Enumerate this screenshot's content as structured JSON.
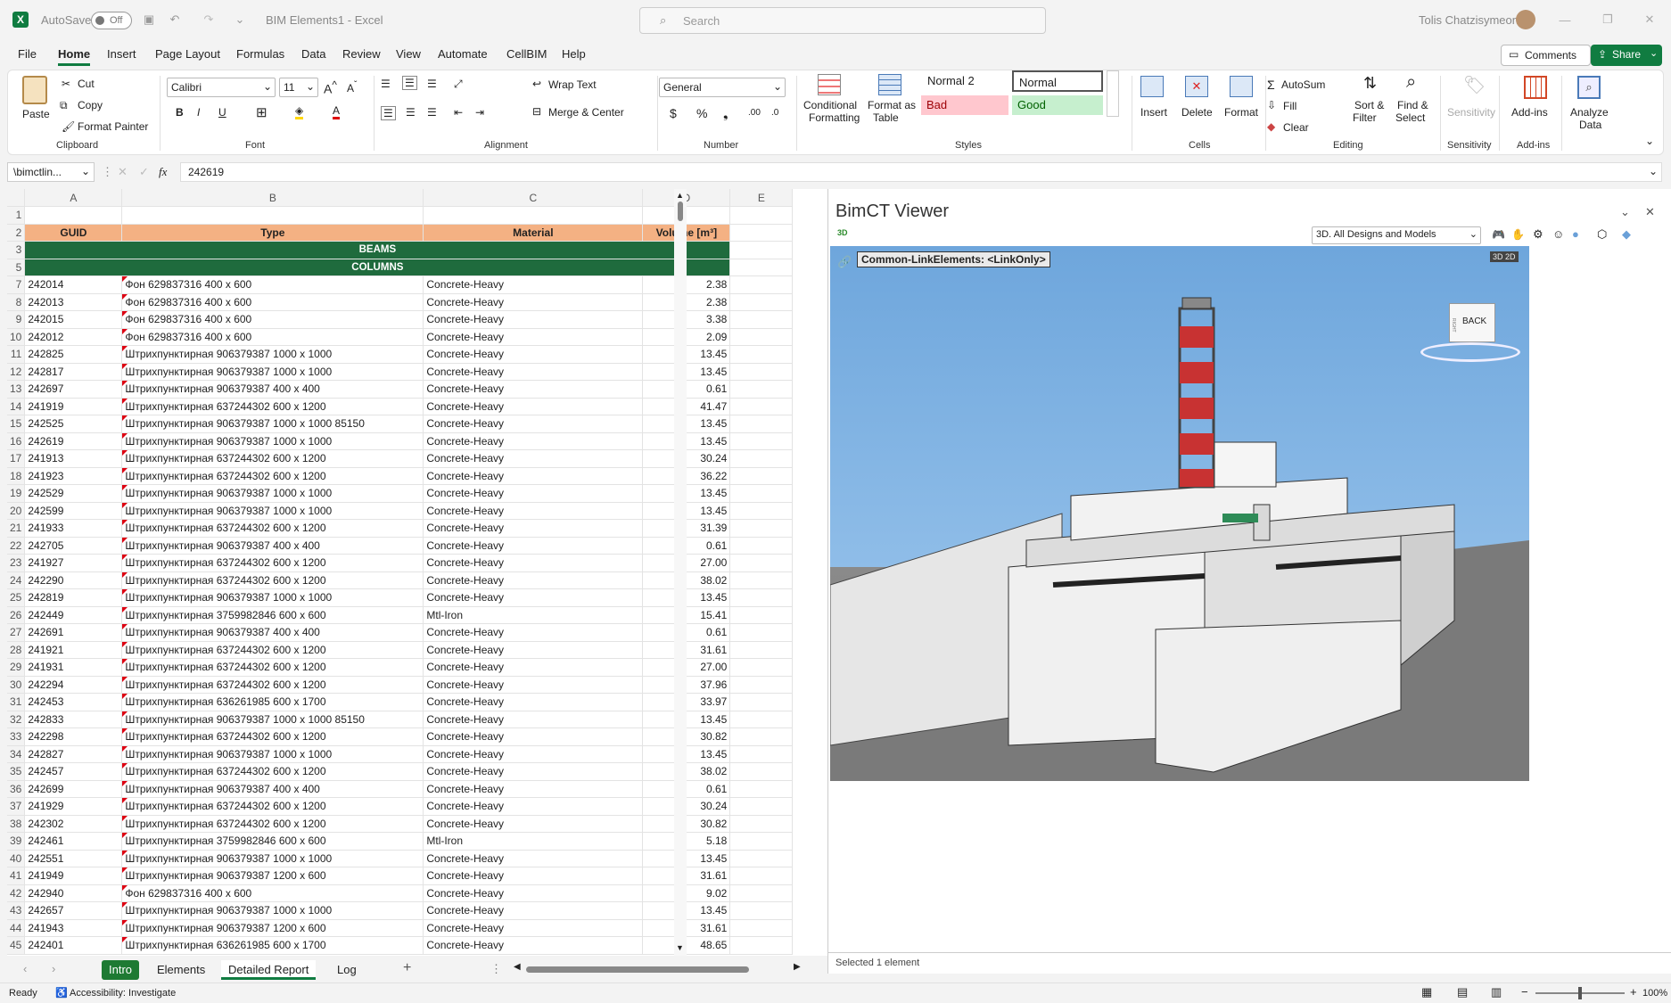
{
  "titlebar": {
    "autosave": "AutoSave",
    "autosave_state": "Off",
    "doc_title": "BIM Elements1  -  Excel",
    "search_placeholder": "Search",
    "user": "Tolis Chatzisymeon"
  },
  "menu": [
    "File",
    "Home",
    "Insert",
    "Page Layout",
    "Formulas",
    "Data",
    "Review",
    "View",
    "Automate",
    "CellBIM",
    "Help"
  ],
  "menu_active": "Home",
  "comments_label": "Comments",
  "share_label": "Share",
  "ribbon": {
    "paste": "Paste",
    "cut": "Cut",
    "copy": "Copy",
    "format_painter": "Format Painter",
    "clipboard": "Clipboard",
    "font_name": "Calibri",
    "font_size": "11",
    "font": "Font",
    "wrap_text": "Wrap Text",
    "merge_center": "Merge & Center",
    "alignment": "Alignment",
    "number_format": "General",
    "number": "Number",
    "cond_fmt": [
      "Conditional",
      "Formatting"
    ],
    "fmt_table": [
      "Format as",
      "Table"
    ],
    "style_normal2": "Normal 2",
    "style_normal": "Normal",
    "style_bad": "Bad",
    "style_good": "Good",
    "styles": "Styles",
    "insert": "Insert",
    "delete": "Delete",
    "format": "Format",
    "cells": "Cells",
    "autosum": "AutoSum",
    "fill": "Fill",
    "clear": "Clear",
    "sort_filter": [
      "Sort &",
      "Filter"
    ],
    "find_select": [
      "Find &",
      "Select"
    ],
    "editing": "Editing",
    "sensitivity": "Sensitivity",
    "sensitivity_grp": "Sensitivity",
    "addins": "Add-ins",
    "addins_grp": "Add-ins",
    "analyze": [
      "Analyze",
      "Data"
    ]
  },
  "formula_bar": {
    "name_box": "\\bimctlin...",
    "fx": "fx",
    "value": "242619"
  },
  "columns": [
    "A",
    "B",
    "C",
    "D",
    "E"
  ],
  "headers": {
    "guid": "GUID",
    "type": "Type",
    "material": "Material",
    "volume": "Volume [m³]"
  },
  "groups": {
    "beams": "BEAMS",
    "columns": "COLUMNS"
  },
  "rows": [
    {
      "r": "7",
      "guid": "242014",
      "type": "Фон 629837316 400 x 600",
      "mat": "Concrete-Heavy",
      "vol": "2.38"
    },
    {
      "r": "8",
      "guid": "242013",
      "type": "Фон 629837316 400 x 600",
      "mat": "Concrete-Heavy",
      "vol": "2.38"
    },
    {
      "r": "9",
      "guid": "242015",
      "type": "Фон 629837316 400 x 600",
      "mat": "Concrete-Heavy",
      "vol": "3.38"
    },
    {
      "r": "10",
      "guid": "242012",
      "type": "Фон 629837316 400 x 600",
      "mat": "Concrete-Heavy",
      "vol": "2.09"
    },
    {
      "r": "11",
      "guid": "242825",
      "type": "Штрихпунктирная 906379387 1000 x 1000",
      "mat": "Concrete-Heavy",
      "vol": "13.45"
    },
    {
      "r": "12",
      "guid": "242817",
      "type": "Штрихпунктирная 906379387 1000 x 1000",
      "mat": "Concrete-Heavy",
      "vol": "13.45"
    },
    {
      "r": "13",
      "guid": "242697",
      "type": "Штрихпунктирная 906379387 400 x 400",
      "mat": "Concrete-Heavy",
      "vol": "0.61"
    },
    {
      "r": "14",
      "guid": "241919",
      "type": "Штрихпунктирная 637244302 600 x 1200",
      "mat": "Concrete-Heavy",
      "vol": "41.47"
    },
    {
      "r": "15",
      "guid": "242525",
      "type": "Штрихпунктирная 906379387 1000 x 1000 85150",
      "mat": "Concrete-Heavy",
      "vol": "13.45"
    },
    {
      "r": "16",
      "guid": "242619",
      "type": "Штрихпунктирная 906379387 1000 x 1000",
      "mat": "Concrete-Heavy",
      "vol": "13.45"
    },
    {
      "r": "17",
      "guid": "241913",
      "type": "Штрихпунктирная 637244302 600 x 1200",
      "mat": "Concrete-Heavy",
      "vol": "30.24"
    },
    {
      "r": "18",
      "guid": "241923",
      "type": "Штрихпунктирная 637244302 600 x 1200",
      "mat": "Concrete-Heavy",
      "vol": "36.22"
    },
    {
      "r": "19",
      "guid": "242529",
      "type": "Штрихпунктирная 906379387 1000 x 1000",
      "mat": "Concrete-Heavy",
      "vol": "13.45"
    },
    {
      "r": "20",
      "guid": "242599",
      "type": "Штрихпунктирная 906379387 1000 x 1000",
      "mat": "Concrete-Heavy",
      "vol": "13.45"
    },
    {
      "r": "21",
      "guid": "241933",
      "type": "Штрихпунктирная 637244302 600 x 1200",
      "mat": "Concrete-Heavy",
      "vol": "31.39"
    },
    {
      "r": "22",
      "guid": "242705",
      "type": "Штрихпунктирная 906379387 400 x 400",
      "mat": "Concrete-Heavy",
      "vol": "0.61"
    },
    {
      "r": "23",
      "guid": "241927",
      "type": "Штрихпунктирная 637244302 600 x 1200",
      "mat": "Concrete-Heavy",
      "vol": "27.00"
    },
    {
      "r": "24",
      "guid": "242290",
      "type": "Штрихпунктирная 637244302 600 x 1200",
      "mat": "Concrete-Heavy",
      "vol": "38.02"
    },
    {
      "r": "25",
      "guid": "242819",
      "type": "Штрихпунктирная 906379387 1000 x 1000",
      "mat": "Concrete-Heavy",
      "vol": "13.45"
    },
    {
      "r": "26",
      "guid": "242449",
      "type": "Штрихпунктирная 3759982846 600 x 600",
      "mat": "Mtl-Iron",
      "vol": "15.41"
    },
    {
      "r": "27",
      "guid": "242691",
      "type": "Штрихпунктирная 906379387 400 x 400",
      "mat": "Concrete-Heavy",
      "vol": "0.61"
    },
    {
      "r": "28",
      "guid": "241921",
      "type": "Штрихпунктирная 637244302 600 x 1200",
      "mat": "Concrete-Heavy",
      "vol": "31.61"
    },
    {
      "r": "29",
      "guid": "241931",
      "type": "Штрихпунктирная 637244302 600 x 1200",
      "mat": "Concrete-Heavy",
      "vol": "27.00"
    },
    {
      "r": "30",
      "guid": "242294",
      "type": "Штрихпунктирная 637244302 600 x 1200",
      "mat": "Concrete-Heavy",
      "vol": "37.96"
    },
    {
      "r": "31",
      "guid": "242453",
      "type": "Штрихпунктирная 636261985 600 x 1700",
      "mat": "Concrete-Heavy",
      "vol": "33.97"
    },
    {
      "r": "32",
      "guid": "242833",
      "type": "Штрихпунктирная 906379387 1000 x 1000 85150",
      "mat": "Concrete-Heavy",
      "vol": "13.45"
    },
    {
      "r": "33",
      "guid": "242298",
      "type": "Штрихпунктирная 637244302 600 x 1200",
      "mat": "Concrete-Heavy",
      "vol": "30.82"
    },
    {
      "r": "34",
      "guid": "242827",
      "type": "Штрихпунктирная 906379387 1000 x 1000",
      "mat": "Concrete-Heavy",
      "vol": "13.45"
    },
    {
      "r": "35",
      "guid": "242457",
      "type": "Штрихпунктирная 637244302 600 x 1200",
      "mat": "Concrete-Heavy",
      "vol": "38.02"
    },
    {
      "r": "36",
      "guid": "242699",
      "type": "Штрихпунктирная 906379387 400 x 400",
      "mat": "Concrete-Heavy",
      "vol": "0.61"
    },
    {
      "r": "37",
      "guid": "241929",
      "type": "Штрихпунктирная 637244302 600 x 1200",
      "mat": "Concrete-Heavy",
      "vol": "30.24"
    },
    {
      "r": "38",
      "guid": "242302",
      "type": "Штрихпунктирная 637244302 600 x 1200",
      "mat": "Concrete-Heavy",
      "vol": "30.82"
    },
    {
      "r": "39",
      "guid": "242461",
      "type": "Штрихпунктирная 3759982846 600 x 600",
      "mat": "Mtl-Iron",
      "vol": "5.18"
    },
    {
      "r": "40",
      "guid": "242551",
      "type": "Штрихпунктирная 906379387 1000 x 1000",
      "mat": "Concrete-Heavy",
      "vol": "13.45"
    },
    {
      "r": "41",
      "guid": "241949",
      "type": "Штрихпунктирная 906379387 1200 x 600",
      "mat": "Concrete-Heavy",
      "vol": "31.61"
    },
    {
      "r": "42",
      "guid": "242940",
      "type": "Фон 629837316 400 x 600",
      "mat": "Concrete-Heavy",
      "vol": "9.02"
    },
    {
      "r": "43",
      "guid": "242657",
      "type": "Штрихпунктирная 906379387 1000 x 1000",
      "mat": "Concrete-Heavy",
      "vol": "13.45"
    },
    {
      "r": "44",
      "guid": "241943",
      "type": "Штрихпунктирная 906379387 1200 x 600",
      "mat": "Concrete-Heavy",
      "vol": "31.61"
    },
    {
      "r": "45",
      "guid": "242401",
      "type": "Штрихпунктирная 636261985 600 x 1700",
      "mat": "Concrete-Heavy",
      "vol": "48.65"
    }
  ],
  "sheet_tabs": [
    "Intro",
    "Elements",
    "Detailed Report",
    "Log"
  ],
  "active_tab": "Detailed Report",
  "viewer": {
    "title": "BimCT Viewer",
    "label_3d": "3D",
    "view_select": "3D. All Designs and Models",
    "link_label": "Common-LinkElements: <LinkOnly>",
    "toggle": "3D 2D",
    "cube_face": "BACK",
    "cube_side": "RIGHT",
    "status": "Selected 1 element"
  },
  "status": {
    "ready": "Ready",
    "accessibility": "Accessibility: Investigate",
    "zoom": "100%"
  }
}
